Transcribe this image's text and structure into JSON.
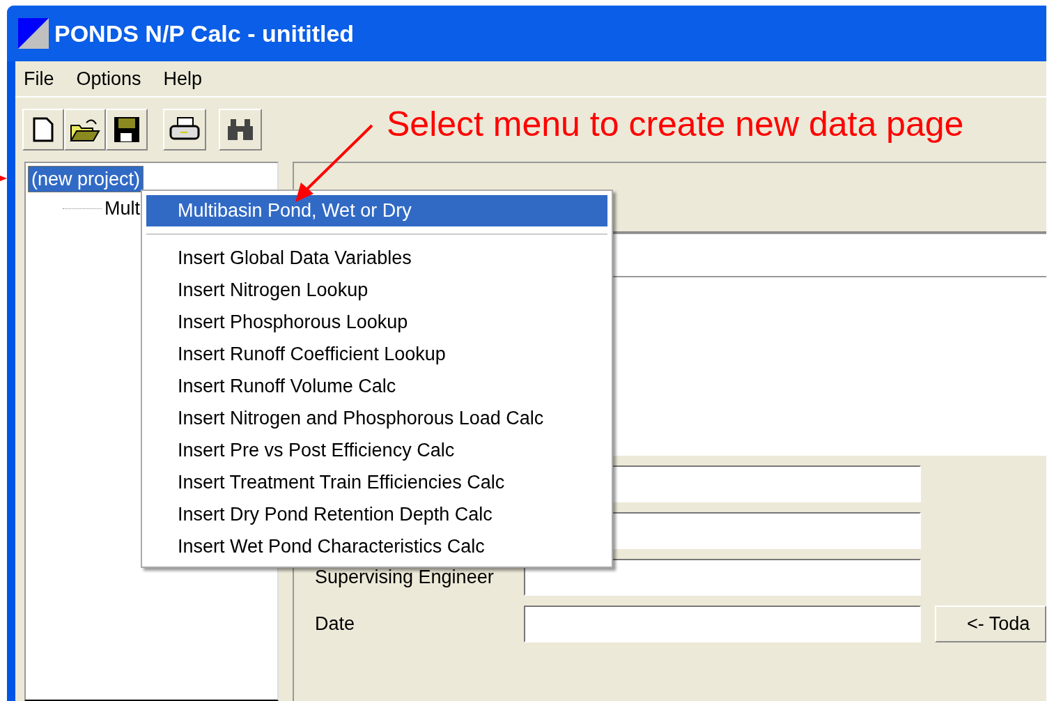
{
  "window": {
    "title": "PONDS N/P Calc - unititled"
  },
  "menu_bar": [
    {
      "label": "File"
    },
    {
      "label": "Options"
    },
    {
      "label": "Help"
    }
  ],
  "tree": {
    "items": [
      {
        "label": "(new project)",
        "selected": true,
        "children": [
          {
            "label": "Mult",
            "selected": false
          }
        ]
      }
    ]
  },
  "context_menu": {
    "items": [
      {
        "kind": "item",
        "label": "Multibasin Pond, Wet or Dry",
        "selected": true
      },
      {
        "kind": "separator"
      },
      {
        "kind": "item",
        "label": "Insert Global Data Variables",
        "selected": false
      },
      {
        "kind": "item",
        "label": "Insert Nitrogen Lookup",
        "selected": false
      },
      {
        "kind": "item",
        "label": "Insert Phosphorous Lookup",
        "selected": false
      },
      {
        "kind": "item",
        "label": "Insert Runoff Coefficient Lookup",
        "selected": false
      },
      {
        "kind": "item",
        "label": "Insert Runoff Volume Calc",
        "selected": false
      },
      {
        "kind": "item",
        "label": "Insert Nitrogen and Phosphorous Load Calc",
        "selected": false
      },
      {
        "kind": "item",
        "label": "Insert Pre vs Post Efficiency Calc",
        "selected": false
      },
      {
        "kind": "item",
        "label": "Insert Treatment Train Efficiencies Calc",
        "selected": false
      },
      {
        "kind": "item",
        "label": "Insert Dry Pond Retention Depth Calc",
        "selected": false
      },
      {
        "kind": "item",
        "label": "Insert Wet Pond Characteristics Calc",
        "selected": false
      }
    ]
  },
  "form": {
    "fields": [
      {
        "kind": "input"
      },
      {
        "kind": "input"
      },
      {
        "kind": "labeled_input",
        "label": "Supervising Engineer"
      },
      {
        "kind": "labeled_input",
        "label": "Date"
      }
    ],
    "today_button": "<- Toda"
  },
  "annotation": {
    "text": "Select menu to create new data page"
  }
}
